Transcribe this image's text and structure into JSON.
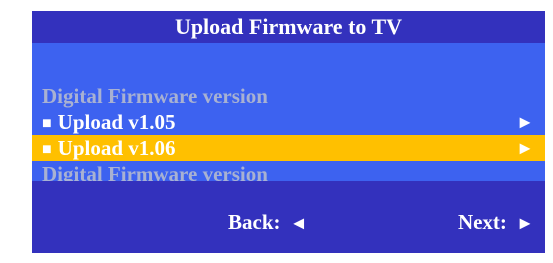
{
  "dialog": {
    "title": "Upload Firmware to TV"
  },
  "menu": {
    "section_top_label": "Digital Firmware version",
    "items": [
      {
        "label": "Upload v1.05",
        "bullet": "■",
        "arrow": "►",
        "selected": false
      },
      {
        "label": "Upload v1.06",
        "bullet": "■",
        "arrow": "►",
        "selected": true
      }
    ],
    "section_bottom_label": "Digital Firmware version"
  },
  "footer": {
    "back_label": "Back:",
    "back_arrow": "◄",
    "next_label": "Next:",
    "next_arrow": "►"
  },
  "colors": {
    "panel_background": "#3d62f0",
    "title_bar_background": "#3331bd",
    "footer_background": "#3331bd",
    "selected_row_background": "#ffc000",
    "section_label_text": "#a8b1d2",
    "text": "#ffffff"
  },
  "icons": {
    "bullet": "square-bullet-icon",
    "row_arrow": "arrow-right-icon",
    "back_arrow": "arrow-left-icon",
    "next_arrow": "arrow-right-icon"
  }
}
